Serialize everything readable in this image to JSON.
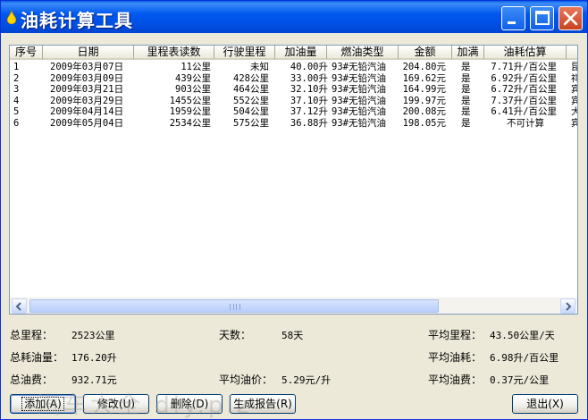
{
  "window": {
    "title": "油耗计算工具"
  },
  "columns": [
    "序号",
    "日期",
    "里程表读数",
    "行驶里程",
    "加油量",
    "燃油类型",
    "金额",
    "加满",
    "油耗估算",
    "加"
  ],
  "rows": [
    {
      "no": "1",
      "date": "2009年03月07日",
      "odo": "11公里",
      "dist": "未知",
      "fuel": "40.00升",
      "type": "93#无铅汽油",
      "amount": "204.80元",
      "full": "是",
      "est": "7.71升/百公里",
      "extra": "昆"
    },
    {
      "no": "2",
      "date": "2009年03月09日",
      "odo": "439公里",
      "dist": "428公里",
      "fuel": "33.00升",
      "type": "93#无铅汽油",
      "amount": "169.62元",
      "full": "是",
      "est": "6.92升/百公里",
      "extra": "祥"
    },
    {
      "no": "3",
      "date": "2009年03月21日",
      "odo": "903公里",
      "dist": "464公里",
      "fuel": "32.10升",
      "type": "93#无铅汽油",
      "amount": "164.99元",
      "full": "是",
      "est": "6.72升/百公里",
      "extra": "宾"
    },
    {
      "no": "4",
      "date": "2009年03月29日",
      "odo": "1455公里",
      "dist": "552公里",
      "fuel": "37.10升",
      "type": "93#无铅汽油",
      "amount": "199.97元",
      "full": "是",
      "est": "7.37升/百公里",
      "extra": "宾"
    },
    {
      "no": "5",
      "date": "2009年04月14日",
      "odo": "1959公里",
      "dist": "504公里",
      "fuel": "37.12升",
      "type": "93#无铅汽油",
      "amount": "200.08元",
      "full": "是",
      "est": "6.41升/百公里",
      "extra": "大"
    },
    {
      "no": "6",
      "date": "2009年05月04日",
      "odo": "2534公里",
      "dist": "575公里",
      "fuel": "36.88升",
      "type": "93#无铅汽油",
      "amount": "198.05元",
      "full": "是",
      "est": "不可计算",
      "extra": "宾"
    }
  ],
  "stats": {
    "total_dist_label": "总里程：",
    "total_dist": "2523公里",
    "days_label": "天数：",
    "days": "58天",
    "avg_dist_label": "平均里程：",
    "avg_dist": "43.50公里/天",
    "total_fuel_label": "总耗油量：",
    "total_fuel": "176.20升",
    "avg_cons_label": "平均油耗：",
    "avg_cons": "6.98升/百公里",
    "total_cost_label": "总油费：",
    "total_cost": "932.71元",
    "avg_price_label": "平均油价：",
    "avg_price": "5.29元/升",
    "avg_cost_label": "平均油费：",
    "avg_cost": "0.37元/公里"
  },
  "buttons": {
    "add": "添加(A)",
    "edit": "修改(U)",
    "delete": "删除(D)",
    "report": "生成报告(R)",
    "exit": "退出(X)"
  },
  "watermark": "汽车大全 diy.piz",
  "colors": {
    "titlebar": "#0054e3",
    "close": "#e04a2a",
    "face": "#ece9d8"
  }
}
